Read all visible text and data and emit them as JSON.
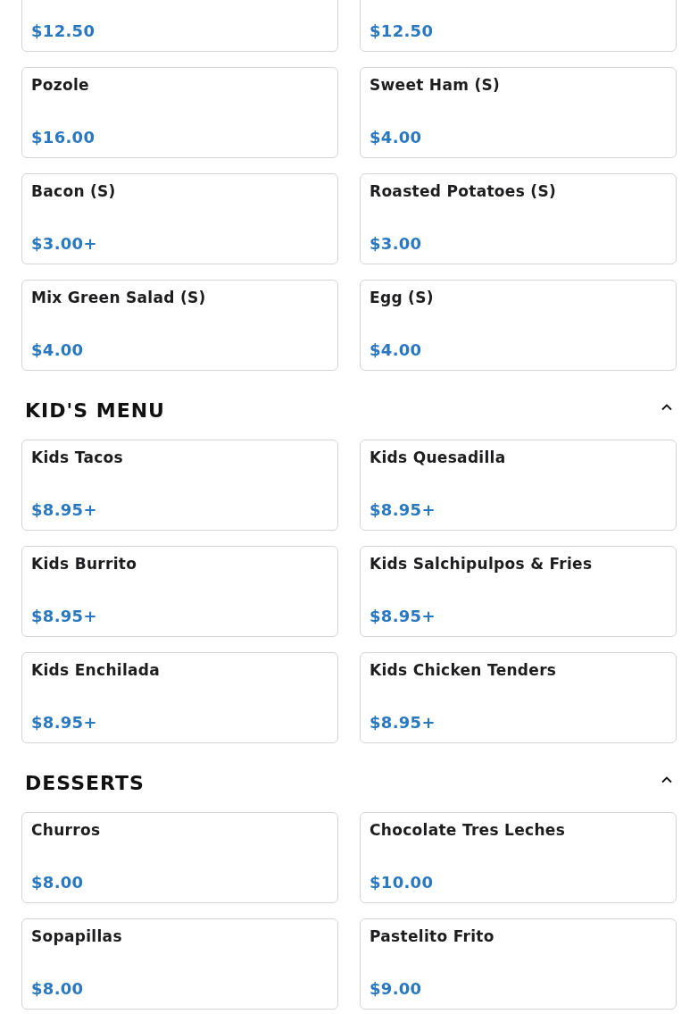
{
  "sections": [
    {
      "items": [
        {
          "price": "$12.50"
        },
        {
          "price": "$12.50"
        },
        {
          "name": "Pozole",
          "price": "$16.00"
        },
        {
          "name": "Sweet Ham (S)",
          "price": "$4.00"
        },
        {
          "name": "Bacon (S)",
          "price": "$3.00+"
        },
        {
          "name": "Roasted Potatoes (S)",
          "price": "$3.00"
        },
        {
          "name": "Mix Green Salad (S)",
          "price": "$4.00"
        },
        {
          "name": "Egg (S)",
          "price": "$4.00"
        }
      ]
    },
    {
      "title": "KID'S MENU",
      "expanded": true,
      "items": [
        {
          "name": "Kids Tacos",
          "price": "$8.95+"
        },
        {
          "name": "Kids Quesadilla",
          "price": "$8.95+"
        },
        {
          "name": "Kids Burrito",
          "price": "$8.95+"
        },
        {
          "name": "Kids Salchipulpos & Fries",
          "price": "$8.95+"
        },
        {
          "name": "Kids Enchilada",
          "price": "$8.95+"
        },
        {
          "name": "Kids Chicken Tenders",
          "price": "$8.95+"
        }
      ]
    },
    {
      "title": "DESSERTS",
      "expanded": true,
      "items": [
        {
          "name": "Churros",
          "price": "$8.00"
        },
        {
          "name": "Chocolate Tres Leches",
          "price": "$10.00"
        },
        {
          "name": "Sopapillas",
          "price": "$8.00"
        },
        {
          "name": "Pastelito Frito",
          "price": "$9.00"
        }
      ]
    }
  ]
}
